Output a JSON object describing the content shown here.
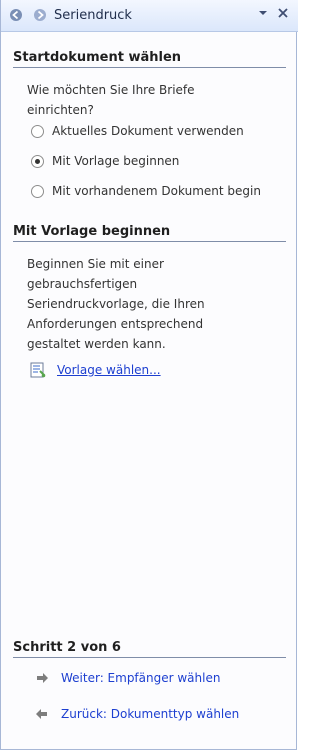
{
  "panel": {
    "title": "Seriendruck",
    "icons": {
      "back": "back-arrow-icon",
      "forward": "forward-arrow-icon",
      "menu": "menu-chevron-icon",
      "close": "close-icon"
    }
  },
  "section1": {
    "title": "Startdokument wählen",
    "question_line1": "Wie möchten Sie Ihre Briefe",
    "question_line2": "einrichten?",
    "options": [
      {
        "label": "Aktuelles Dokument verwenden",
        "selected": false
      },
      {
        "label": "Mit Vorlage beginnen",
        "selected": true
      },
      {
        "label": "Mit vorhandenem Dokument begin",
        "selected": false
      }
    ]
  },
  "section2": {
    "title": "Mit Vorlage beginnen",
    "description_lines": [
      "Beginnen Sie mit einer",
      "gebrauchsfertigen",
      "Seriendruckvorlage, die Ihren",
      "Anforderungen entsprechend",
      "gestaltet werden kann."
    ],
    "link_label": "Vorlage wählen..."
  },
  "step": {
    "title": "Schritt 2 von 6",
    "next_label": "Weiter: Empfänger wählen",
    "back_label": "Zurück: Dokumenttyp wählen"
  }
}
